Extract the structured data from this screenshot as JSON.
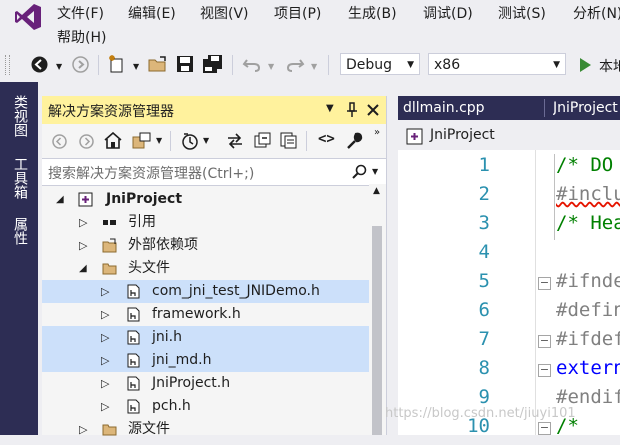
{
  "menu": {
    "items": [
      "文件(F)",
      "编辑(E)",
      "视图(V)",
      "项目(P)",
      "生成(B)",
      "调试(D)",
      "测试(S)",
      "分析(N)",
      "帮助(H)"
    ]
  },
  "toolbar": {
    "config": "Debug",
    "platform": "x86",
    "run_label": "本地"
  },
  "left_tabs": [
    "类视图",
    "工具箱",
    "属性"
  ],
  "solution_explorer": {
    "title": "解决方案资源管理器",
    "search_placeholder": "搜索解决方案资源管理器(Ctrl+;)",
    "tree": [
      {
        "label": "JniProject",
        "icon": "cpp-project-icon",
        "expander": "expanded"
      },
      {
        "label": "引用",
        "icon": "references-icon",
        "expander": "collapsed"
      },
      {
        "label": "外部依赖项",
        "icon": "external-deps-icon",
        "expander": "collapsed"
      },
      {
        "label": "头文件",
        "icon": "folder-icon",
        "expander": "expanded"
      },
      {
        "label": "com_jni_test_JNIDemo.h",
        "icon": "header-file-icon",
        "expander": "collapsed",
        "selected": true
      },
      {
        "label": "framework.h",
        "icon": "header-file-icon",
        "expander": "collapsed"
      },
      {
        "label": "jni.h",
        "icon": "header-file-icon",
        "expander": "collapsed",
        "selected": true
      },
      {
        "label": "jni_md.h",
        "icon": "header-file-icon",
        "expander": "collapsed",
        "selected": true
      },
      {
        "label": "JniProject.h",
        "icon": "header-file-icon",
        "expander": "collapsed"
      },
      {
        "label": "pch.h",
        "icon": "header-file-icon",
        "expander": "collapsed"
      },
      {
        "label": "源文件",
        "icon": "folder-icon",
        "expander": "collapsed"
      }
    ]
  },
  "editor": {
    "tabs": [
      "dllmain.cpp",
      "JniProject"
    ],
    "nav_project": "JniProject",
    "lines": [
      {
        "n": "1",
        "text": "/* DO",
        "style": "cmt"
      },
      {
        "n": "2",
        "text": "#inclu",
        "style": "pp"
      },
      {
        "n": "3",
        "text": "/* Hea",
        "style": "cmt"
      },
      {
        "n": "4",
        "text": "",
        "style": "pp"
      },
      {
        "n": "5",
        "text": "#ifnde",
        "style": "pp"
      },
      {
        "n": "6",
        "text": "#defin",
        "style": "pp"
      },
      {
        "n": "7",
        "text": "#ifdef",
        "style": "pp"
      },
      {
        "n": "8",
        "text": "extern",
        "style": "kw"
      },
      {
        "n": "9",
        "text": "#endif",
        "style": "pp"
      },
      {
        "n": "10",
        "text": "/*",
        "style": "cmt"
      }
    ]
  },
  "watermark": "https://blog.csdn.net/jiuyi101"
}
